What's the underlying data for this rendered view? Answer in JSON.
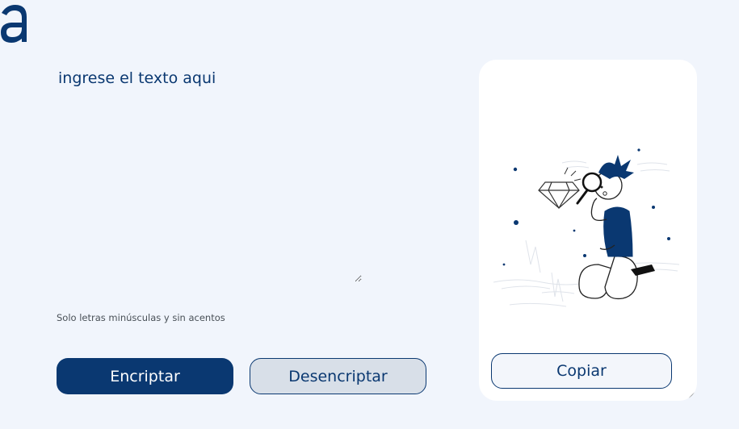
{
  "colors": {
    "primary": "#0a3871",
    "background": "#f1f5fc",
    "panel": "#ffffff",
    "secondary_button": "#d8dfe8",
    "hint_text": "#495057"
  },
  "logo": {
    "icon": "alura-logo-icon"
  },
  "input": {
    "placeholder": "ingrese el texto aqui",
    "value": ""
  },
  "hint": {
    "text": "Solo letras minúsculas y sin acentos",
    "icon": "info-icon"
  },
  "actions": {
    "encrypt_label": "Encriptar",
    "decrypt_label": "Desencriptar"
  },
  "output": {
    "illustration": "boy-with-magnifying-glass-illustration",
    "copy_label": "Copiar"
  }
}
